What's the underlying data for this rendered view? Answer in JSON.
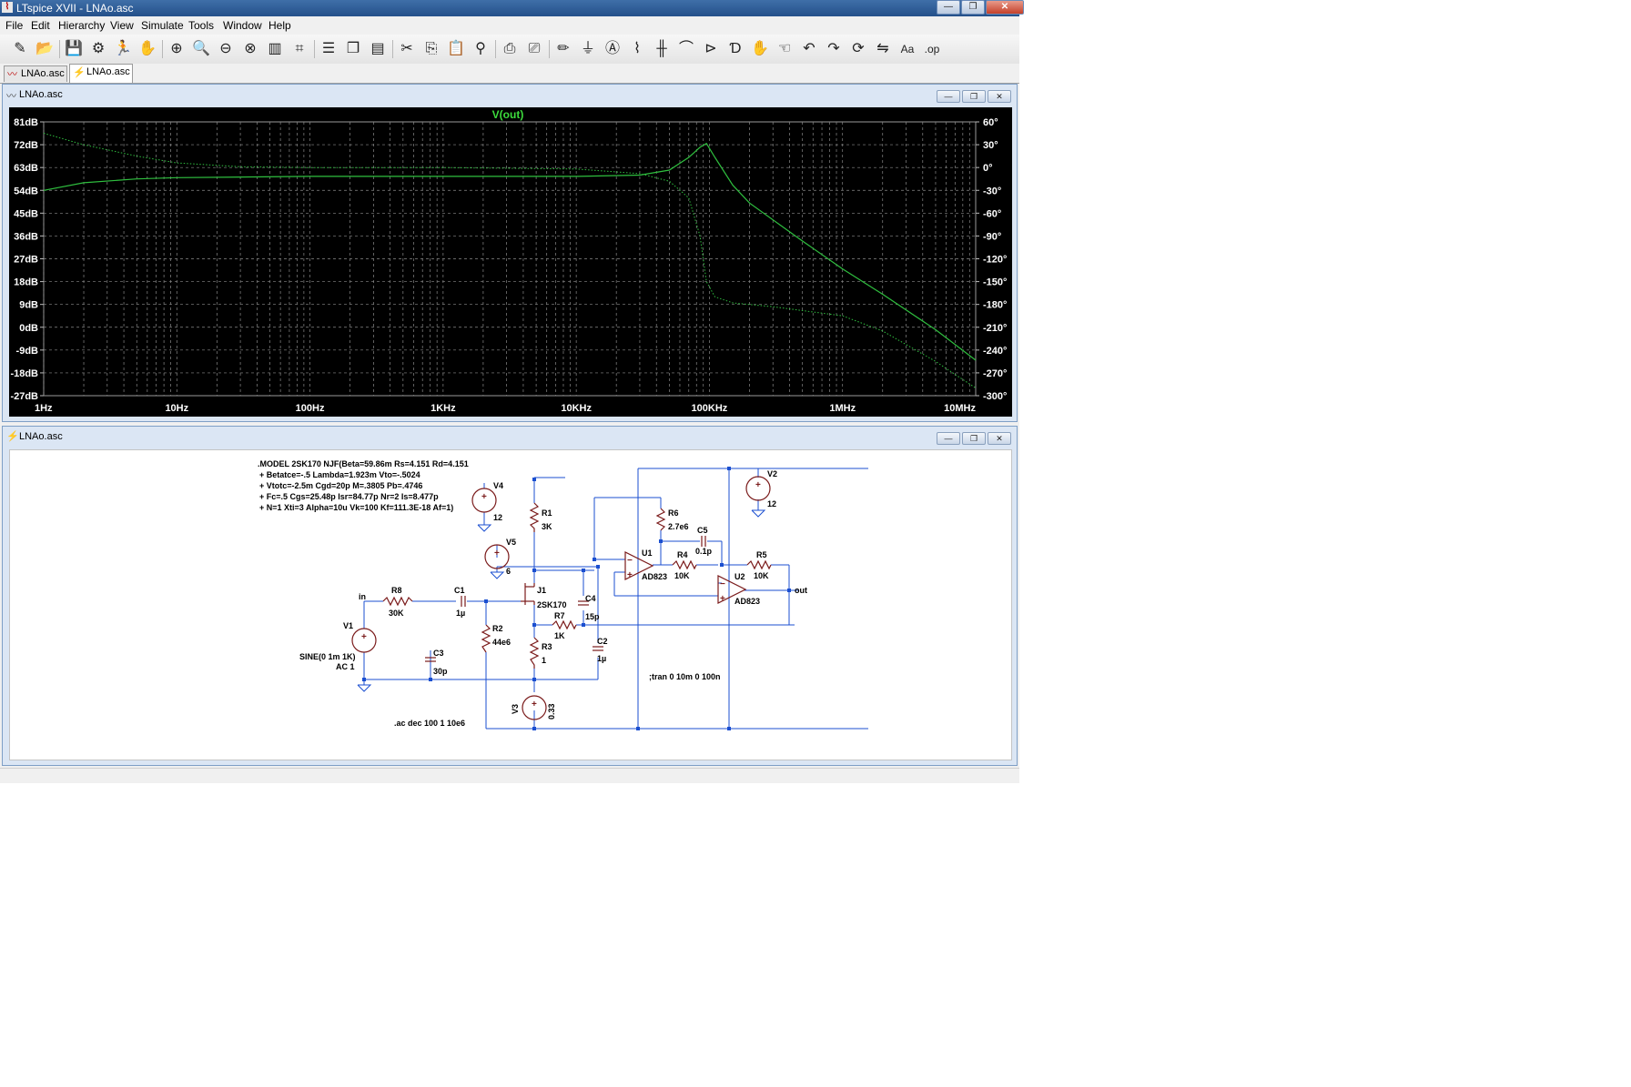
{
  "window": {
    "title": "LTspice XVII - LNAo.asc",
    "min_glyph": "—",
    "max_glyph": "❐",
    "close_glyph": "✕"
  },
  "menu": [
    "File",
    "Edit",
    "Hierarchy",
    "View",
    "Simulate",
    "Tools",
    "Window",
    "Help"
  ],
  "toolbar": {
    "icons": [
      "new-schematic-icon",
      "open-icon",
      "save-icon",
      "control-panel-icon",
      "run-icon",
      "halt-icon",
      "zoom-in-icon",
      "zoom-full-icon",
      "zoom-out-icon",
      "zoom-cancel-icon",
      "autorange-icon",
      "cursor-icon",
      "tile-horizontal-icon",
      "cascade-icon",
      "tile-vertical-icon",
      "cut-icon",
      "copy-icon",
      "paste-icon",
      "find-icon",
      "print-icon",
      "print-setup-icon",
      "draw-wire-icon",
      "ground-icon",
      "label-net-icon",
      "resistor-icon",
      "capacitor-icon",
      "inductor-icon",
      "diode-icon",
      "component-icon",
      "move-icon",
      "drag-icon",
      "undo-icon",
      "redo-icon",
      "rotate-icon",
      "mirror-icon",
      "text-icon",
      "spice-directive-icon"
    ],
    "glyphs": [
      "✎",
      "📂",
      "💾",
      "⚙",
      "🏃",
      "✋",
      "⊕",
      "🔍",
      "⊖",
      "⊗",
      "▥",
      "⌗",
      "☰",
      "❐",
      "▤",
      "✂",
      "⎘",
      "📋",
      "⚲",
      "⎙",
      "⎚",
      "✏",
      "⏚",
      "Ⓐ",
      "⌇",
      "╫",
      "⌒",
      "⊳",
      "Ɗ",
      "✋",
      "☜",
      "↶",
      "↷",
      "⟳",
      "⇋",
      "Aa",
      ".op"
    ],
    "spice_label": ".op",
    "text_label": "Aa"
  },
  "tabs": [
    {
      "label": "LNAo.asc",
      "icon": "waveform-icon",
      "glyph": "〰"
    },
    {
      "label": "LNAo.asc",
      "icon": "schematic-icon",
      "glyph": "⚡"
    }
  ],
  "plot_window": {
    "title": "LNAo.asc",
    "icon_glyph": "〰"
  },
  "schematic_window": {
    "title": "LNAo.asc",
    "icon_glyph": "⚡"
  },
  "mdi_buttons": {
    "min": "—",
    "max": "❐",
    "close": "✕"
  },
  "colors": {
    "plot_bg": "#000000",
    "trace": "#2fbf3f",
    "trace_title": "#3ddc3d",
    "axis_text": "#ffffff",
    "wire": "#1b4fd0",
    "component": "#7a1a1a"
  },
  "chart_data": {
    "type": "line",
    "title": "V(out)",
    "xscale": "log",
    "xlim": [
      1,
      10000000
    ],
    "x_ticks": [
      "1Hz",
      "10Hz",
      "100Hz",
      "1KHz",
      "10KHz",
      "100KHz",
      "1MHz",
      "10MHz"
    ],
    "ylim_left": [
      -27,
      81
    ],
    "y_ticks_left": [
      "81dB",
      "72dB",
      "63dB",
      "54dB",
      "45dB",
      "36dB",
      "27dB",
      "18dB",
      "9dB",
      "0dB",
      "-9dB",
      "-18dB",
      "-27dB"
    ],
    "ylim_right": [
      -300,
      60
    ],
    "y_ticks_right": [
      "60°",
      "30°",
      "0°",
      "-30°",
      "-60°",
      "-90°",
      "-120°",
      "-150°",
      "-180°",
      "-210°",
      "-240°",
      "-270°",
      "-300°"
    ],
    "grid": true,
    "series": [
      {
        "name": "magnitude",
        "style": "solid",
        "x": [
          1,
          2,
          5,
          10,
          100,
          1000,
          10000,
          30000,
          50000,
          70000,
          85000,
          95000,
          110000,
          150000,
          200000,
          500000,
          1000000,
          2000000,
          5000000,
          10000000
        ],
        "y": [
          54,
          57,
          58.5,
          59,
          59.5,
          59.5,
          59.5,
          60,
          62,
          67,
          71,
          72.5,
          67,
          56,
          49,
          34,
          23,
          13,
          -1,
          -13
        ]
      },
      {
        "name": "phase",
        "style": "dotted",
        "x": [
          1,
          2,
          5,
          10,
          30,
          100,
          1000,
          10000,
          30000,
          50000,
          70000,
          85000,
          95000,
          110000,
          150000,
          300000,
          1000000,
          2000000,
          5000000,
          10000000
        ],
        "y": [
          45,
          30,
          15,
          6,
          1,
          0,
          0,
          -2,
          -8,
          -18,
          -40,
          -90,
          -150,
          -170,
          -178,
          -183,
          -195,
          -215,
          -255,
          -290
        ]
      }
    ]
  },
  "schematic": {
    "model_lines": [
      ".MODEL 2SK170 NJF(Beta=59.86m Rs=4.151 Rd=4.151",
      "+ Betatce=-.5 Lambda=1.923m Vto=-.5024",
      "+ Vtotc=-2.5m Cgd=20p M=.3805 Pb=.4746",
      "+ Fc=.5 Cgs=25.48p Isr=84.77p Nr=2 Is=8.477p",
      "+ N=1 Xti=3 Alpha=10u Vk=100 Kf=111.3E-18 Af=1)"
    ],
    "labels": {
      "V4": "V4",
      "V4v": "12",
      "V5": "V5",
      "V5v": "6",
      "R1": "R1",
      "R1v": "3K",
      "J1": "J1",
      "J1v": "2SK170",
      "C4": "C4",
      "C4v": "15p",
      "R7": "R7",
      "R7v": "1K",
      "C2": "C2",
      "C2v": "1µ",
      "R3": "R3",
      "R3v": "1",
      "V3": "V3",
      "V3v": "0.33",
      "R8": "R8",
      "R8v": "30K",
      "C1": "C1",
      "C1v": "1µ",
      "R2": "R2",
      "R2v": "44e6",
      "V1": "V1",
      "V1v1": "SINE(0 1m 1K)",
      "V1v2": "AC 1",
      "C3": "C3",
      "C3v": "30p",
      "in": "in",
      "R6": "R6",
      "R6v": "2.7e6",
      "C5": "C5",
      "C5v": "0.1p",
      "U1": "U1",
      "U1v": "AD823",
      "R4": "R4",
      "R4v": "10K",
      "R5": "R5",
      "R5v": "10K",
      "U2": "U2",
      "U2v": "AD823",
      "out": "out",
      "V2": "V2",
      "V2v": "12"
    },
    "directives": {
      "tran": ";tran 0 10m 0 100n",
      "ac": ".ac dec 100 1 10e6"
    }
  }
}
